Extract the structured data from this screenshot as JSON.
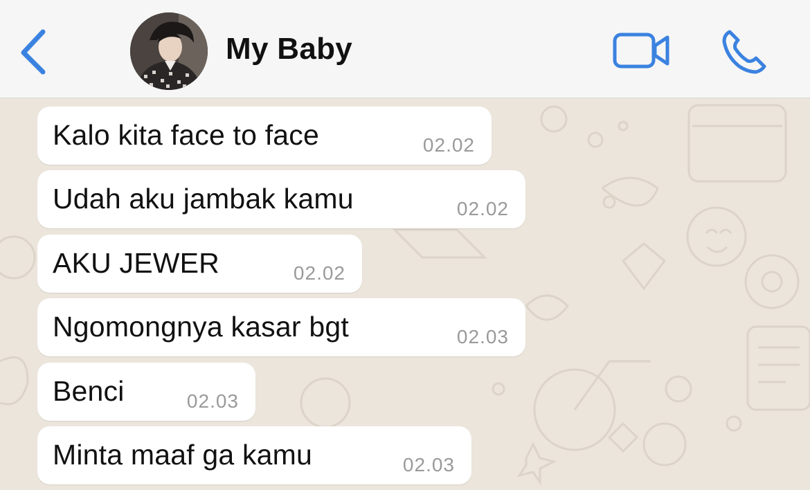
{
  "header": {
    "contact_name": "My Baby",
    "back_icon": "chevron-left-icon",
    "video_icon": "video-camera-icon",
    "call_icon": "phone-icon",
    "accent_color": "#3b82e0"
  },
  "messages": [
    {
      "text": "Kalo kita face to face",
      "time": "02.02"
    },
    {
      "text": "Udah aku jambak kamu",
      "time": "02.02"
    },
    {
      "text": "AKU JEWER",
      "time": "02.02"
    },
    {
      "text": "Ngomongnya kasar bgt",
      "time": "02.03"
    },
    {
      "text": "Benci",
      "time": "02.03"
    },
    {
      "text": "Minta maaf ga kamu",
      "time": "02.03"
    }
  ],
  "colors": {
    "wallpaper": "#ece5dc",
    "bubble": "#ffffff",
    "timestamp": "#9a9a9a"
  }
}
